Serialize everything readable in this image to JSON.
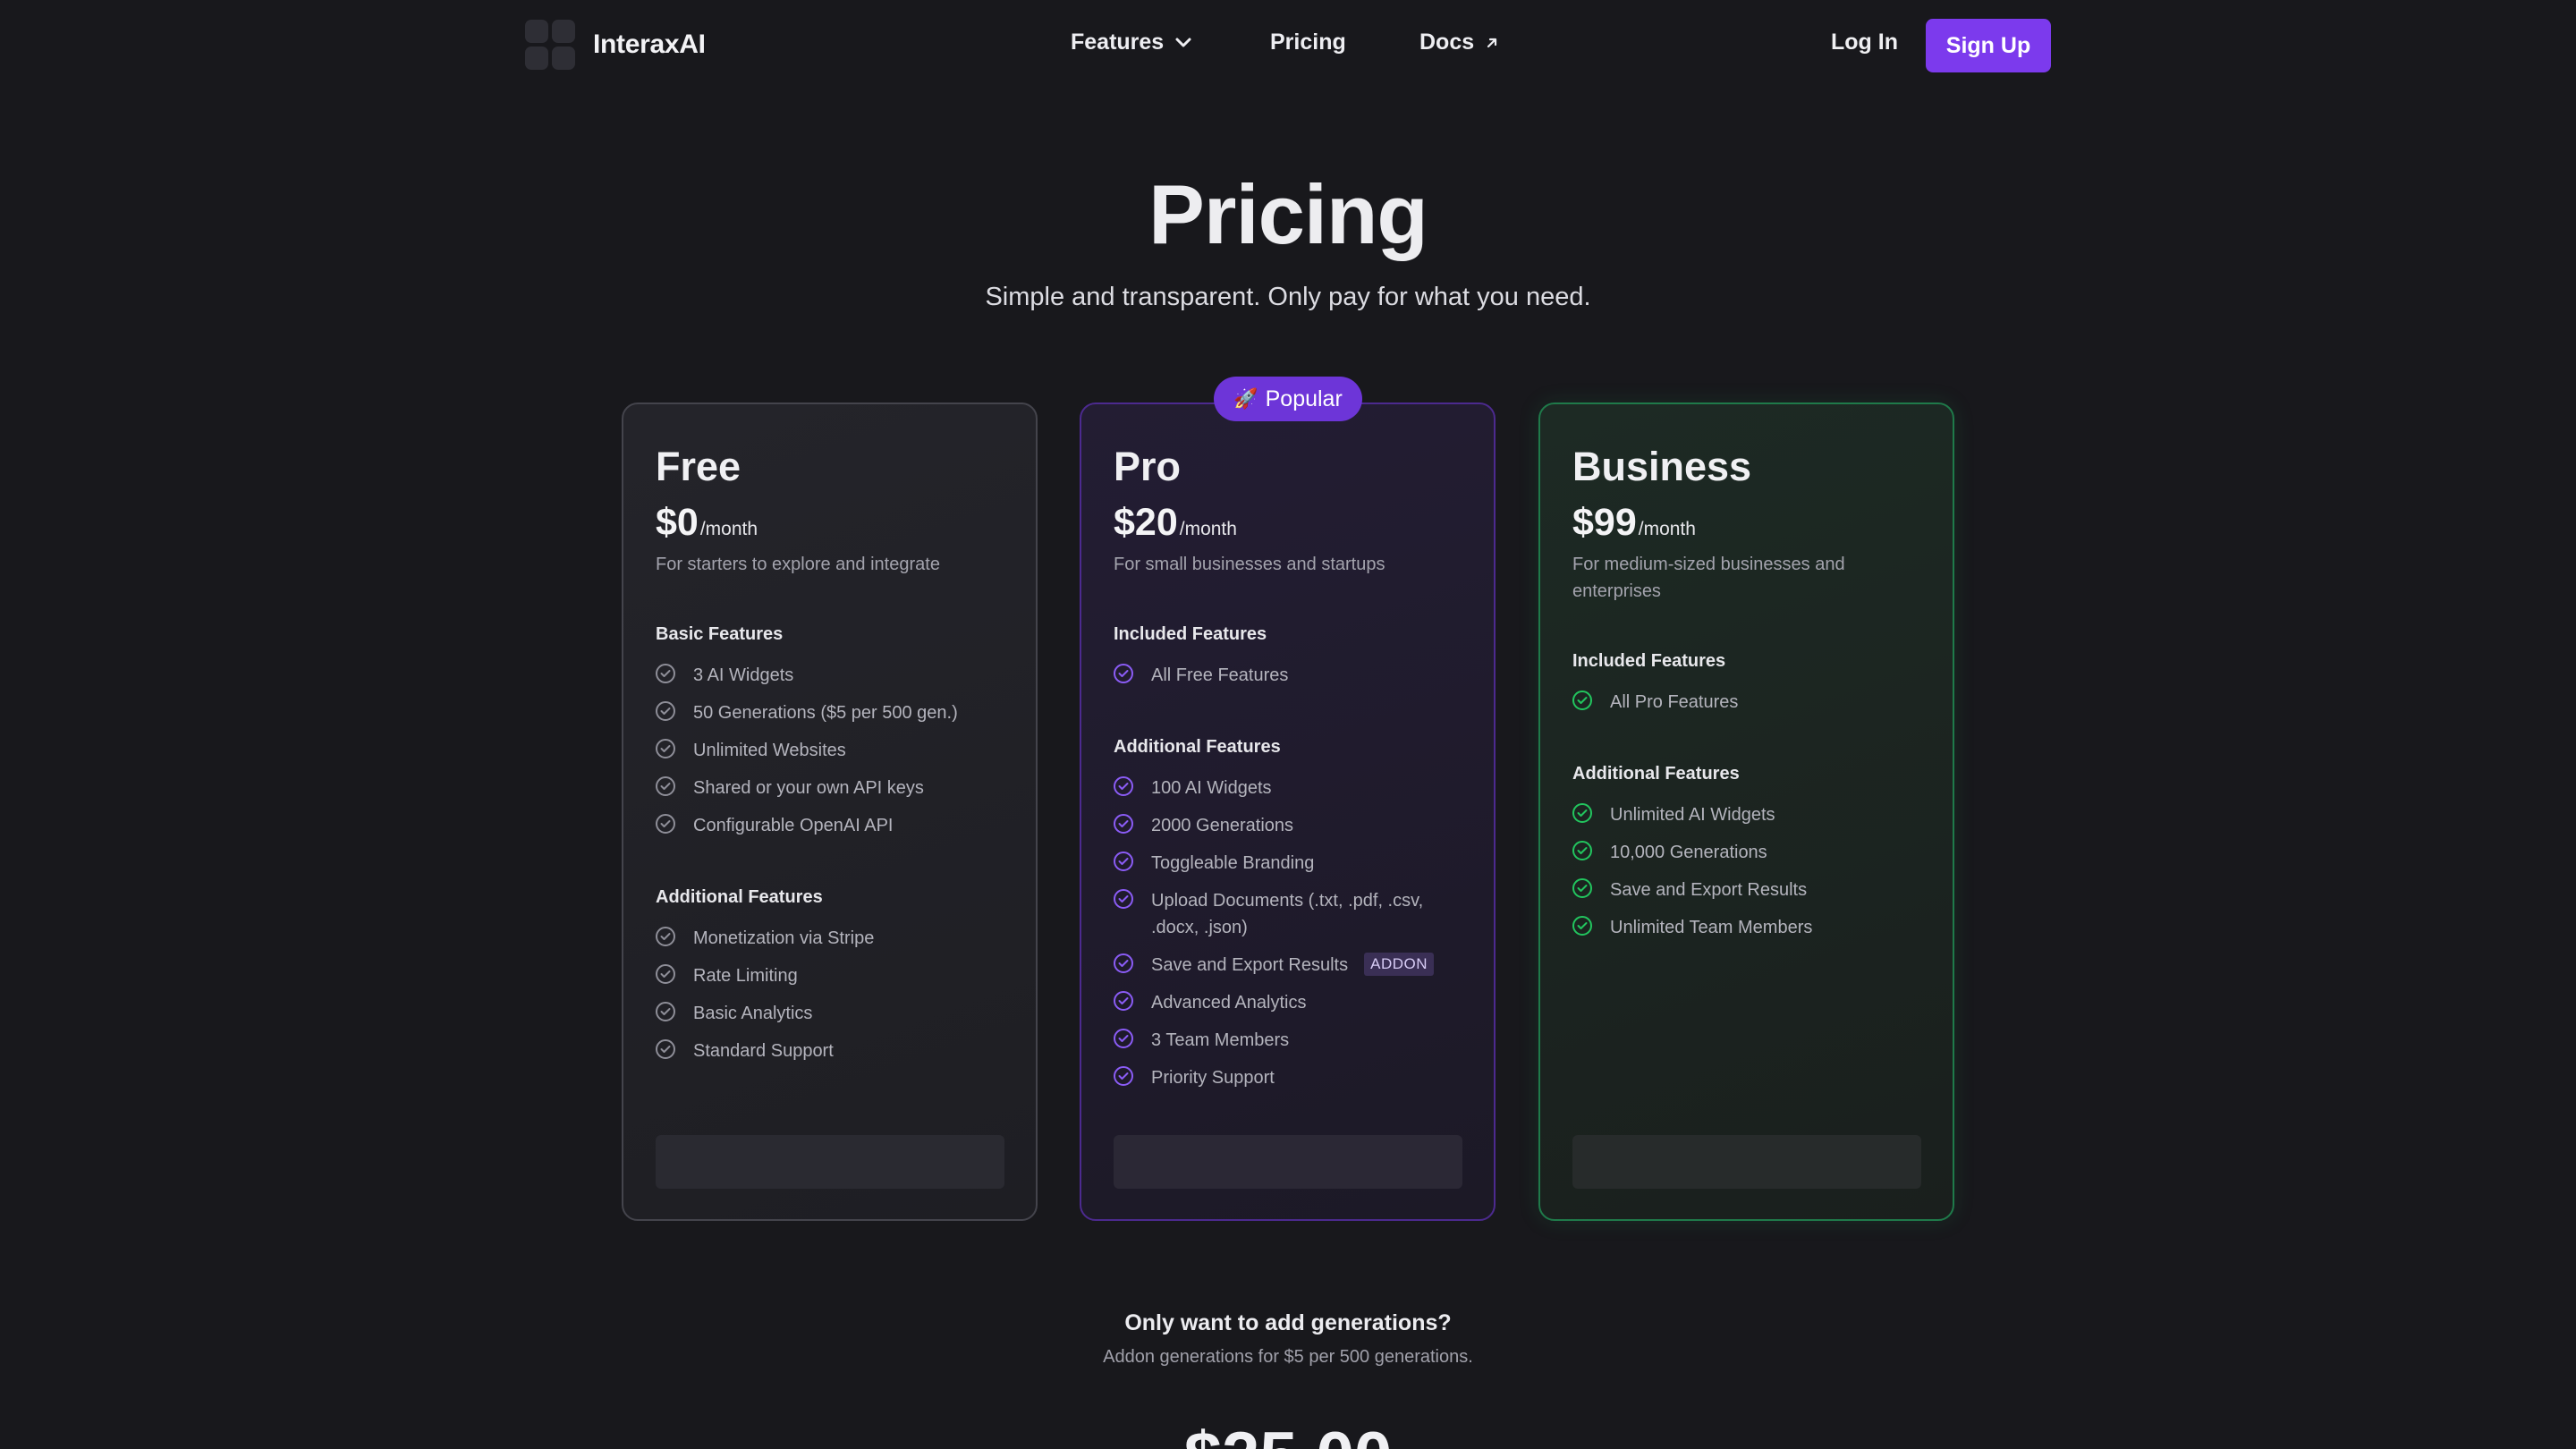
{
  "brand": {
    "name": "InteraxAI"
  },
  "nav": {
    "features": "Features",
    "pricing": "Pricing",
    "docs": "Docs",
    "login": "Log In",
    "signup": "Sign Up"
  },
  "hero": {
    "title": "Pricing",
    "subtitle": "Simple and transparent. Only pay for what you need."
  },
  "popular_badge": "Popular",
  "plans": [
    {
      "name": "Free",
      "price": "$0",
      "per": "/month",
      "desc": "For starters to explore and integrate",
      "sections": [
        {
          "title": "Basic Features",
          "items": [
            "3 AI Widgets",
            "50 Generations ($5 per 500 gen.)",
            "Unlimited Websites",
            "Shared or your own API keys",
            "Configurable OpenAI API"
          ]
        },
        {
          "title": "Additional Features",
          "items": [
            "Monetization via Stripe",
            "Rate Limiting",
            "Basic Analytics",
            "Standard Support"
          ]
        }
      ]
    },
    {
      "name": "Pro",
      "price": "$20",
      "per": "/month",
      "desc": "For small businesses and startups",
      "sections": [
        {
          "title": "Included Features",
          "items": [
            "All Free Features"
          ]
        },
        {
          "title": "Additional Features",
          "items": [
            "100 AI Widgets",
            "2000 Generations",
            "Toggleable Branding",
            "Upload Documents (.txt, .pdf, .csv, .docx, .json)",
            "Save and Export Results",
            "Advanced Analytics",
            "3 Team Members",
            "Priority Support"
          ]
        }
      ],
      "addon_label": "ADDON"
    },
    {
      "name": "Business",
      "price": "$99",
      "per": "/month",
      "desc": "For medium-sized businesses and enterprises",
      "sections": [
        {
          "title": "Included Features",
          "items": [
            "All Pro Features"
          ]
        },
        {
          "title": "Additional Features",
          "items": [
            "Unlimited AI Widgets",
            "10,000 Generations",
            "Save and Export Results",
            "Unlimited Team Members"
          ]
        }
      ]
    }
  ],
  "addon": {
    "question": "Only want to add generations?",
    "subtitle": "Addon generations for $5 per 500 generations.",
    "price": "$25.00"
  },
  "colors": {
    "background": "#18181c",
    "accent": "#7c3aed",
    "pro_border": "#4c2a8f",
    "business_border": "#1f7a4a"
  }
}
